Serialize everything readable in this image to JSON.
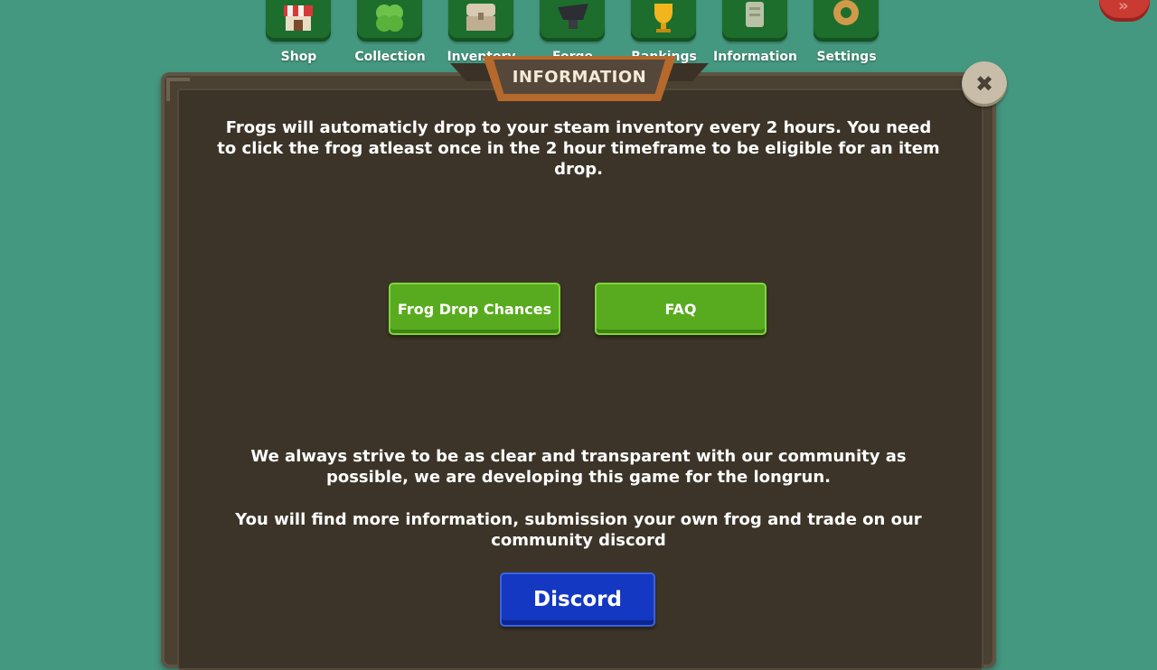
{
  "nav": {
    "items": [
      {
        "label": "Shop",
        "icon": "shop-icon"
      },
      {
        "label": "Collection",
        "icon": "clover-icon"
      },
      {
        "label": "Inventory",
        "icon": "chest-icon"
      },
      {
        "label": "Forge",
        "icon": "anvil-icon"
      },
      {
        "label": "Rankings",
        "icon": "trophy-icon"
      },
      {
        "label": "Information",
        "icon": "scroll-icon"
      },
      {
        "label": "Settings",
        "icon": "gear-icon"
      }
    ]
  },
  "corner_button": {
    "glyph": "»",
    "icon": "double-chevron-icon"
  },
  "dialog": {
    "title": "INFORMATION",
    "close_glyph": "✖",
    "intro": "Frogs will automaticly drop to your steam inventory every 2 hours. You need to click the frog atleast once in the 2 hour timeframe to be eligible for an item drop.",
    "buttons": {
      "drop_chances": "Frog Drop Chances",
      "faq": "FAQ",
      "discord": "Discord"
    },
    "community": "We always strive to be as clear and transparent with our community as possible, we are developing this game for the longrun.",
    "more_info": "You will find more information, submission your own frog and trade on our community discord"
  },
  "colors": {
    "background": "#459880",
    "nav_tile": "#1d6e2d",
    "panel": "#3c3428",
    "green_button": "#58ab1e",
    "blue_button": "#1438c2",
    "title_plate": "#b5692c"
  }
}
